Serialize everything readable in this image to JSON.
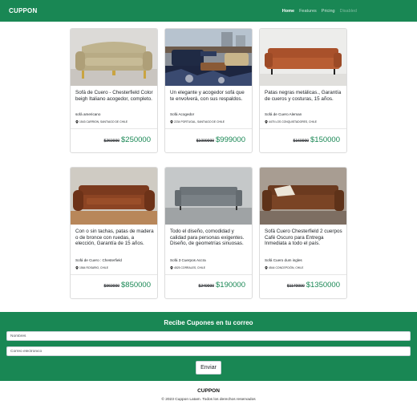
{
  "nav": {
    "brand": "CUPPON",
    "links": [
      {
        "label": "Home"
      },
      {
        "label": "Features"
      },
      {
        "label": "Pricing"
      },
      {
        "label": "Disabled"
      }
    ]
  },
  "cards": [
    {
      "title": "Sofá de Cuero - Chesterfield Color beigh Italiano acogedor, completo.",
      "subtitle": "sofá americano",
      "location": "1543 CARRION, SANTIAGO DE CHILE",
      "old_price": "$260000",
      "new_price": "$250000"
    },
    {
      "title": "Un elegante y acogedor sofá que te envolverá, con sus respaldos.",
      "subtitle": "Sofá Acogedor",
      "location": "2234 PORTUGAL, SANTIAGO DE CHILE",
      "old_price": "$1090000",
      "new_price": "$999000"
    },
    {
      "title": "Patas negras metálicas., Garantía de cueros y costuras, 15 años.",
      "subtitle": "Sofá de Cuero Aleman",
      "location": "4475 LOS CONQUISTADORES, CHILE",
      "old_price": "$160000",
      "new_price": "$150000"
    },
    {
      "title": "Con o sin tachas, patas de madera o de bronce con ruedas, a elección, Garantía de 15 años.",
      "subtitle": "Sofá de Cuero : Chesterfield",
      "location": "1564 ROSARIO, CHILE",
      "old_price": "$960000",
      "new_price": "$850000"
    },
    {
      "title": "Todo el diseño, comodidad y calidad para personas exigentes. Diseño, de geometrías sinuosas.",
      "subtitle": "Sofá 3 Cuerpos Accra",
      "location": "4525 CORRALES, CHILE",
      "old_price": "$240000",
      "new_price": "$190000"
    },
    {
      "title": "Sofá Cuero Chesterfield 2 cuerpos Café Oscuro para Entrega Inmediata a todo el país.",
      "subtitle": "Sofá Cuero dum ingles",
      "location": "4544 CONCEPCIÓN, CHILE",
      "old_price": "$1170000",
      "new_price": "$1350000"
    }
  ],
  "newsletter": {
    "title": "Recibe Cupones en tu correo",
    "name_placeholder": "Nombres",
    "email_placeholder": "Correo electronico",
    "button": "Enviar"
  },
  "footer": {
    "brand": "CUPPON",
    "copyright": "© 2023 Cuppon Latam. Todos los derechos reservados"
  },
  "colors": {
    "brand_green": "#198754",
    "price_green": "#198754"
  }
}
